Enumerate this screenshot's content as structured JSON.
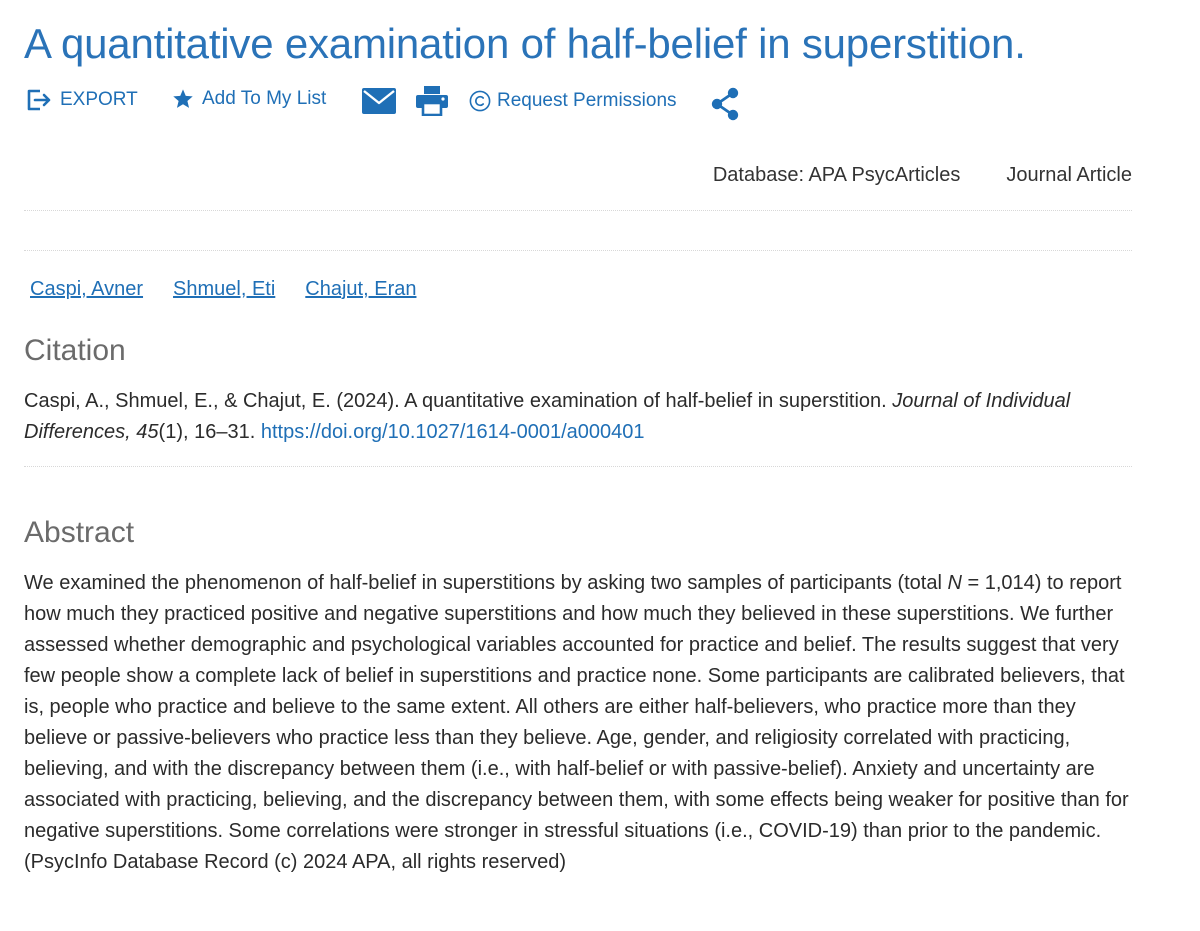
{
  "article": {
    "title": "A quantitative examination of half-belief in superstition."
  },
  "toolbar": {
    "export_label": "EXPORT",
    "add_to_list_label": "Add To My List",
    "request_permissions_label": "Request Permissions",
    "icons": [
      "export-icon",
      "star-icon",
      "email-icon",
      "print-icon",
      "copyright-icon",
      "share-icon"
    ],
    "accent_color": "#1f6fb6"
  },
  "meta": {
    "database": "Database: APA PsycArticles",
    "type": "Journal Article"
  },
  "authors": [
    "Caspi, Avner",
    "Shmuel, Eti",
    "Chajut, Eran"
  ],
  "citation": {
    "heading": "Citation",
    "authors_year_title": "Caspi, A., Shmuel, E., & Chajut, E. (2024). A quantitative examination of half-belief in superstition.",
    "journal": "Journal of Individual Differences,",
    "volume": "45",
    "issue_pages": "(1), 16–31.",
    "doi": "https://doi.org/10.1027/1614-0001/a000401"
  },
  "abstract": {
    "heading": "Abstract",
    "text_before_n": "We examined the phenomenon of half-belief in superstitions by asking two samples of participants (total",
    "n_symbol": "N",
    "text_after_n": "= 1,014) to report how much they practiced positive and negative superstitions and how much they believed in these superstitions. We further assessed whether demographic and psychological variables accounted for practice and belief. The results suggest that very few people show a complete lack of belief in superstitions and practice none. Some participants are calibrated believers, that is, people who practice and believe to the same extent. All others are either half-believers, who practice more than they believe or passive-believers who practice less than they believe. Age, gender, and religiosity correlated with practicing, believing, and with the discrepancy between them (i.e., with half-belief or with passive-belief). Anxiety and uncertainty are associated with practicing, believing, and the discrepancy between them, with some effects being weaker for positive than for negative superstitions. Some correlations were stronger in stressful situations (i.e., COVID-19) than prior to the pandemic. (PsycInfo Database Record (c) 2024 APA, all rights reserved)"
  }
}
